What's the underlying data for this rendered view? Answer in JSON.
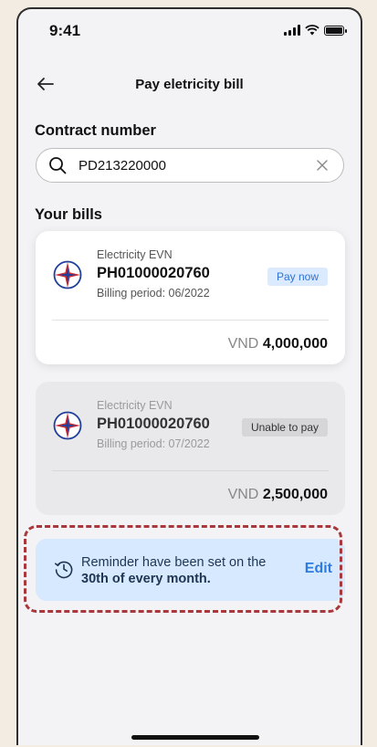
{
  "status_bar": {
    "time": "9:41"
  },
  "header": {
    "title": "Pay eletricity bill"
  },
  "contract": {
    "section_title": "Contract number",
    "search_value": "PD213220000"
  },
  "bills": {
    "section_title": "Your bills",
    "items": [
      {
        "provider": "Electricity EVN",
        "number": "PH01000020760",
        "period": "Billing period: 06/2022",
        "action_label": "Pay now",
        "currency": "VND",
        "amount": "4,000,000"
      },
      {
        "provider": "Electricity EVN",
        "number": "PH01000020760",
        "period": "Billing period: 07/2022",
        "action_label": "Unable to pay",
        "currency": "VND",
        "amount": "2,500,000"
      }
    ]
  },
  "reminder": {
    "text": "Reminder have been set on the",
    "text_bold": "30th of every month.",
    "edit_label": "Edit"
  },
  "colors": {
    "accent": "#2e7be0",
    "pay_badge_bg": "#dbeaff",
    "reminder_bg": "#d6e9ff",
    "highlight_border": "#a8383c"
  }
}
